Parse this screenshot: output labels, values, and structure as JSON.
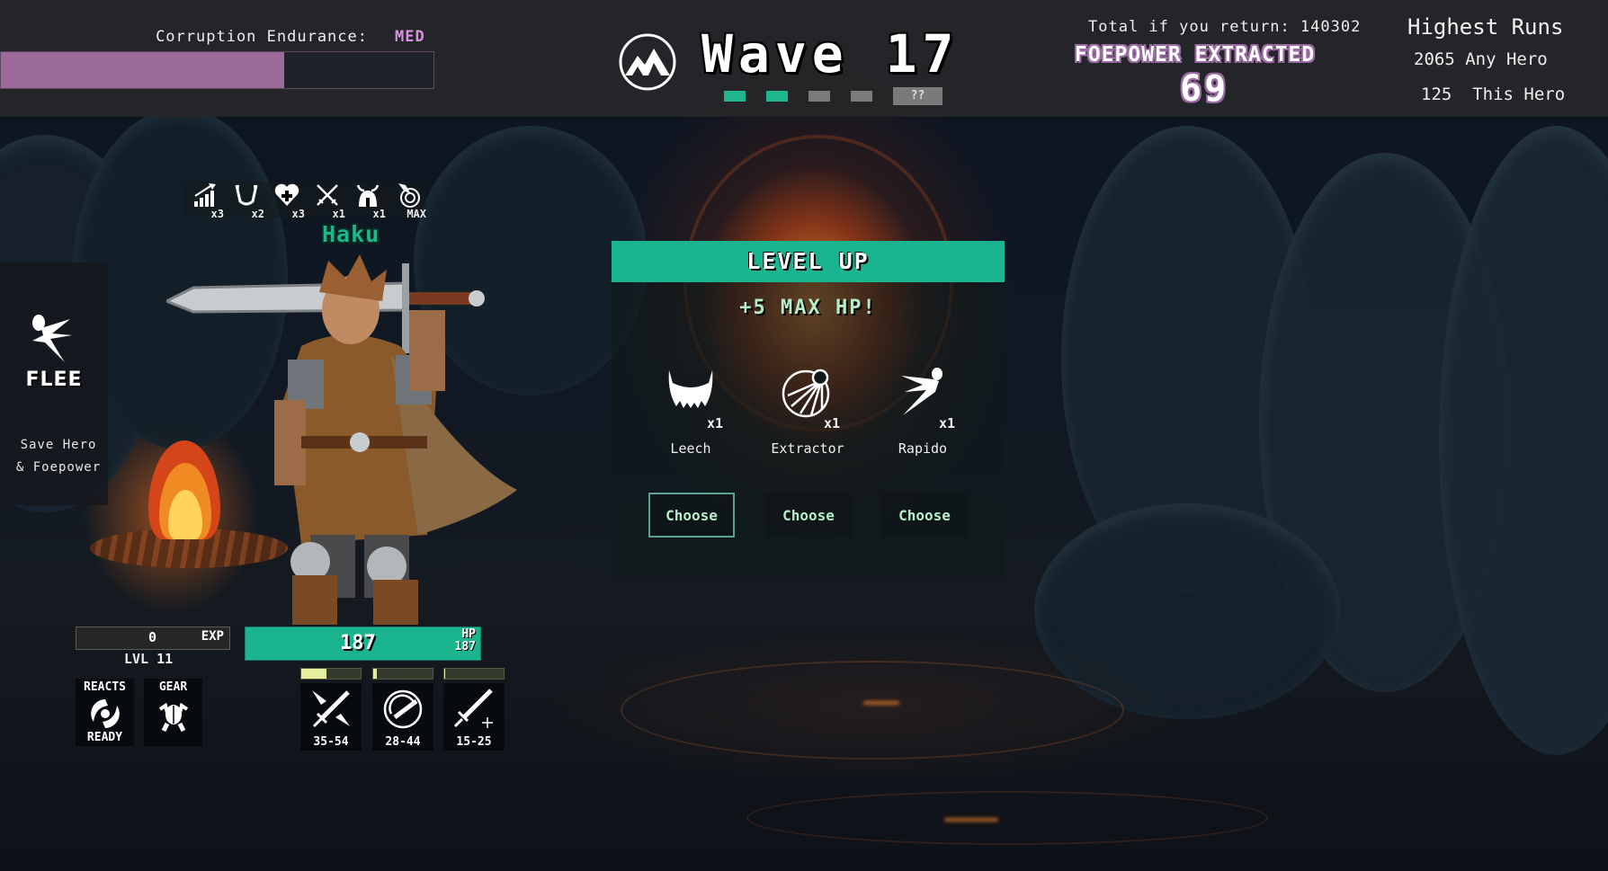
{
  "topbar": {
    "corruption": {
      "label": "Corruption Endurance:",
      "level": "MED",
      "fill_fraction": 0.655,
      "level_color": "#d693e0",
      "fill_color": "#9b6a99"
    },
    "wave": {
      "title": "Wave 17",
      "icon": "mountain-icon",
      "pips": [
        {
          "state": "done"
        },
        {
          "state": "done"
        },
        {
          "state": "pending"
        },
        {
          "state": "pending"
        }
      ],
      "boss_pip_label": "??"
    },
    "foepower": {
      "return_text": "Total if you return: 140302",
      "title": "FOEPOWER EXTRACTED",
      "value": "69"
    },
    "highest_runs": {
      "title": "Highest Runs",
      "rows": [
        {
          "value": "2065",
          "label": "Any Hero"
        },
        {
          "value": "125",
          "label": "This Hero"
        }
      ]
    }
  },
  "flee": {
    "icon": "running-figure-icon",
    "label": "FLEE",
    "sub_line1": "Save Hero",
    "sub_line2": "& Foepower"
  },
  "hero": {
    "name": "Haku",
    "name_color": "#1fb58d",
    "buffs": [
      {
        "icon": "stats-up-icon",
        "count": "x3"
      },
      {
        "icon": "fangs-icon",
        "count": "x2"
      },
      {
        "icon": "heart-plus-icon",
        "count": "x3"
      },
      {
        "icon": "crossed-swords-icon",
        "count": "x1"
      },
      {
        "icon": "horned-helmet-icon",
        "count": "x1"
      },
      {
        "icon": "radar-strike-icon",
        "count": "MAX"
      }
    ]
  },
  "level_up": {
    "title": "LEVEL UP",
    "reward": "+5 MAX HP!",
    "options": [
      {
        "icon": "fangs-icon",
        "count": "x1",
        "name": "Leech",
        "button": "Choose"
      },
      {
        "icon": "extractor-orb-icon",
        "count": "x1",
        "name": "Extractor",
        "button": "Choose"
      },
      {
        "icon": "dash-figure-icon",
        "count": "x1",
        "name": "Rapido",
        "button": "Choose"
      }
    ],
    "accent_color": "#1ab58e"
  },
  "hud": {
    "exp": {
      "value": "0",
      "label": "EXP"
    },
    "level": "LVL 11",
    "hp": {
      "current": "187",
      "label": "HP",
      "max": "187"
    },
    "reacts": {
      "title": "REACTS",
      "status": "READY",
      "icon": "swirl-icon"
    },
    "gear": {
      "title": "GEAR",
      "icon": "armor-icon"
    },
    "skills": [
      {
        "icon": "slash-sword-icon",
        "damage": "35-54",
        "cooldown_fraction": 0.42
      },
      {
        "icon": "spin-sword-icon",
        "damage": "28-44",
        "cooldown_fraction": 0.06
      },
      {
        "icon": "sword-sparkle-icon",
        "damage": "15-25",
        "cooldown_fraction": 0.02
      }
    ]
  }
}
